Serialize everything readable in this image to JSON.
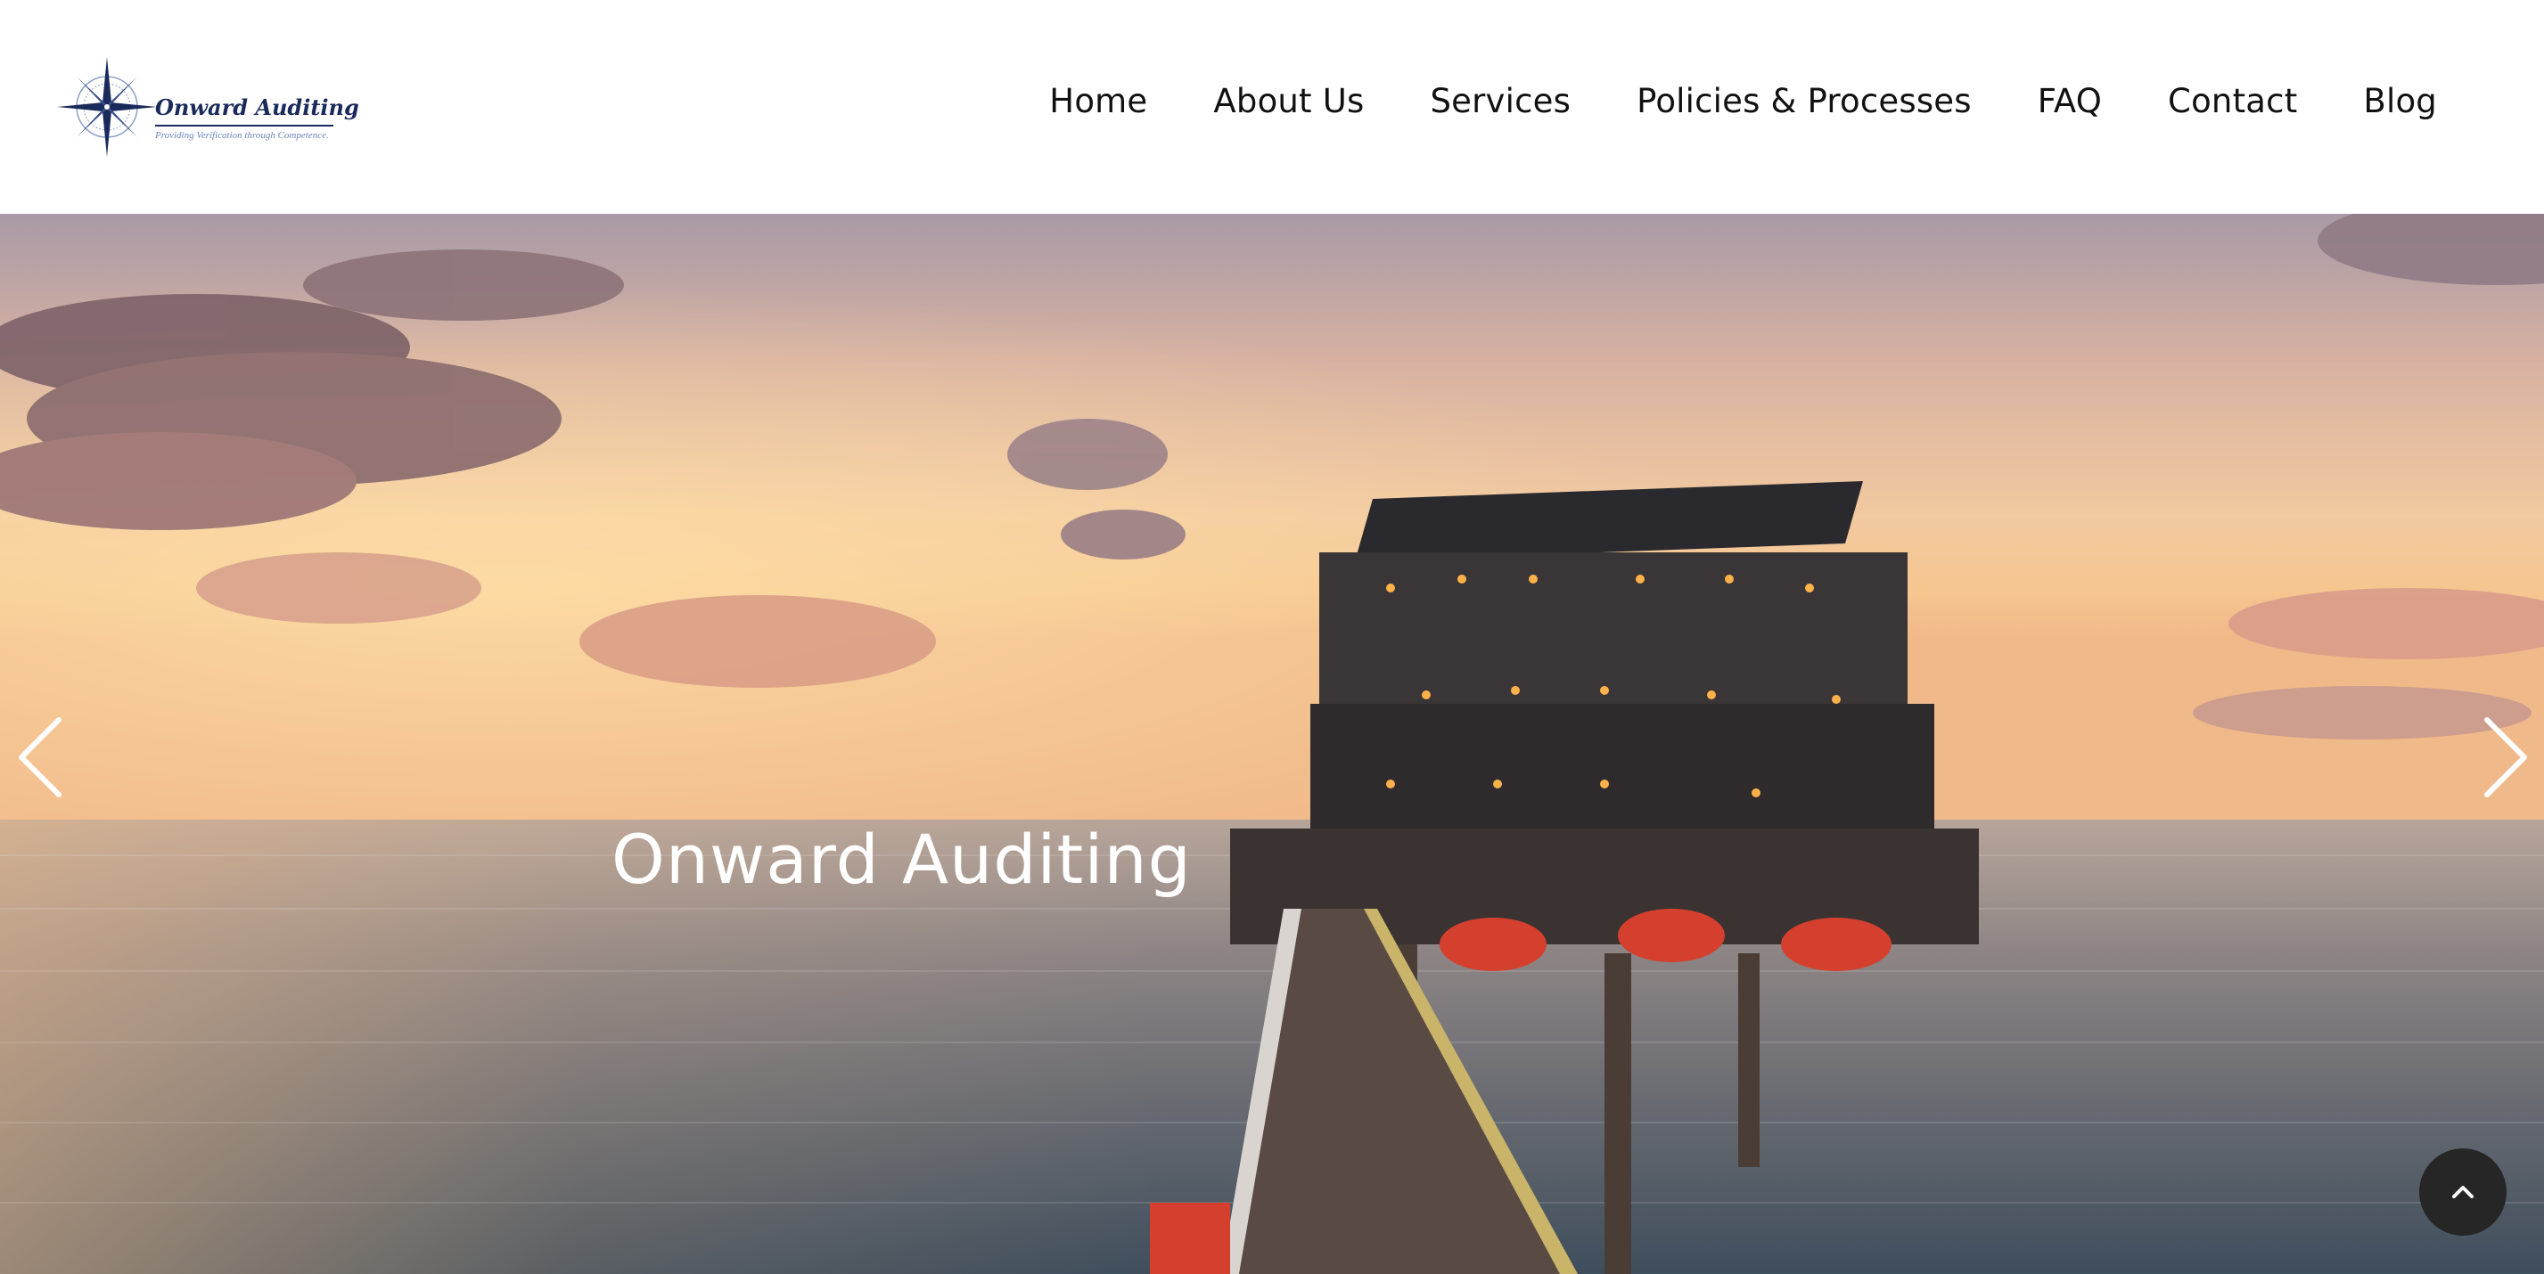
{
  "brand": {
    "name": "Onward Auditing",
    "tagline": "Providing Verification through Competence."
  },
  "nav": {
    "items": [
      {
        "label": "Home"
      },
      {
        "label": "About Us"
      },
      {
        "label": "Services"
      },
      {
        "label": "Policies & Processes"
      },
      {
        "label": "FAQ"
      },
      {
        "label": "Contact"
      },
      {
        "label": "Blog"
      }
    ]
  },
  "hero": {
    "title": "Onward Auditing",
    "image": "offshore-oil-platform-sunset",
    "prev_icon": "chevron-left-icon",
    "next_icon": "chevron-right-icon"
  },
  "back_to_top": {
    "icon": "chevron-up-icon"
  },
  "colors": {
    "brand_navy": "#1a2a5a",
    "tagline_blue": "#6a86c0",
    "back_to_top_bg": "#262626"
  }
}
